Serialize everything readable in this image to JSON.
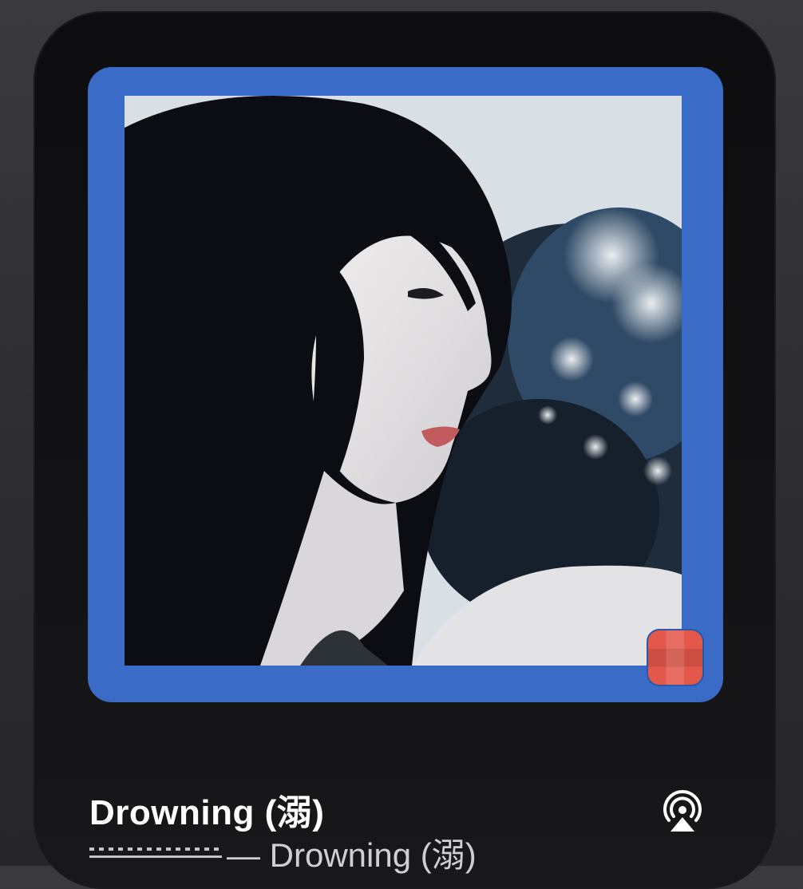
{
  "now_playing": {
    "title": "Drowning (溺)",
    "subtitle": "— Drowning (溺)",
    "artist_redacted": true
  },
  "icons": {
    "output": "airplay-icon",
    "app_badge": "music-app-icon"
  },
  "colors": {
    "album_frame": "#3a6cc7",
    "badge": "#e4584b",
    "background": "#0d0d10"
  }
}
